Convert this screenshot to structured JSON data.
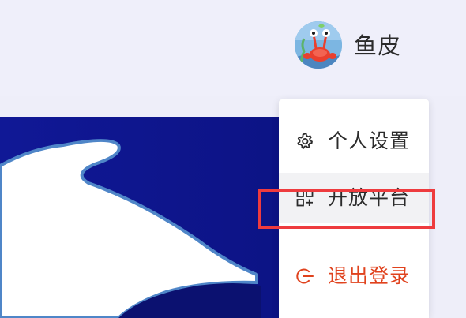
{
  "header": {
    "username": "鱼皮",
    "avatar_icon": "crab-character-avatar"
  },
  "user_menu": {
    "items": [
      {
        "label": "个人设置",
        "icon": "gear-icon"
      },
      {
        "label": "开放平台",
        "icon": "grid-apps-icon"
      },
      {
        "label": "退出登录",
        "icon": "logout-icon",
        "color": "#e0421d"
      }
    ]
  },
  "annotation": {
    "highlight_color": "#ee3b3e"
  }
}
